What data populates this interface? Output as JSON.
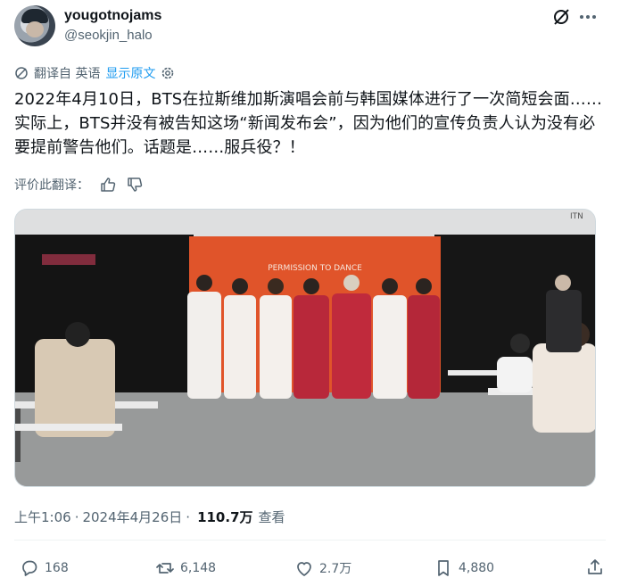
{
  "user": {
    "display_name": "yougotnojams",
    "handle": "@seokjin_halo"
  },
  "translation_bar": {
    "translated_from": "翻译自 英语",
    "show_original": "显示原文"
  },
  "tweet": {
    "text": "2022年4月10日，BTS在拉斯维加斯演唱会前与韩国媒体进行了一次简短会面……实际上，BTS并没有被告知这场“新闻发布会”，因为他们的宣传负责人认为没有必要提前警告他们。话题是……服兵役？！"
  },
  "rate_translation": {
    "label": "评价此翻译："
  },
  "media": {
    "backdrop_text": "PERMISSION TO DANCE",
    "corner_text": "ITN"
  },
  "meta": {
    "time": "上午1:06",
    "date": "2024年4月26日",
    "views_count": "110.7万",
    "views_label": "查看",
    "sep": "·"
  },
  "actions": {
    "replies": "168",
    "reposts": "6,148",
    "likes": "2.7万",
    "bookmarks": "4,880"
  },
  "icons": [
    "grok-icon",
    "more-icon",
    "translate-icon",
    "gear-icon",
    "thumbs-up-icon",
    "thumbs-down-icon",
    "reply-icon",
    "repost-icon",
    "like-icon",
    "bookmark-icon",
    "share-icon"
  ],
  "colors": {
    "text_primary": "#0f1419",
    "text_secondary": "#536471",
    "link_blue": "#1d9bf0",
    "backdrop_orange": "#e0542a"
  }
}
